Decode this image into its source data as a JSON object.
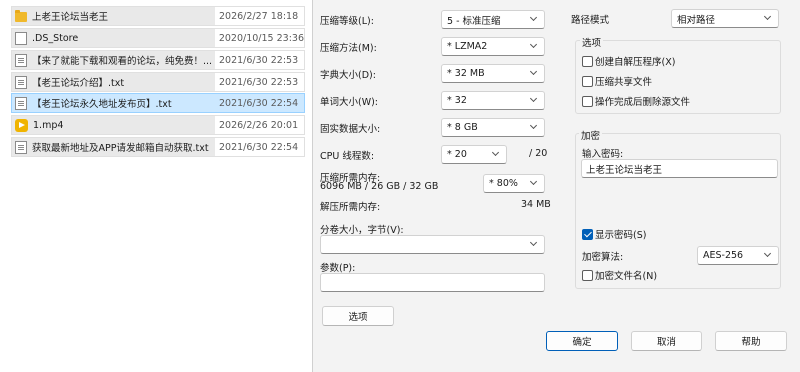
{
  "files": [
    {
      "name": "上老王论坛当老王",
      "date": "2026/2/27 18:18",
      "icon": "folder-icon",
      "selected": false
    },
    {
      "name": ".DS_Store",
      "date": "2020/10/15 23:36",
      "icon": "file-icon",
      "selected": false
    },
    {
      "name": "【来了就能下载和观看的论坛，纯免费！...",
      "date": "2021/6/30 22:53",
      "icon": "text-file-icon",
      "selected": false
    },
    {
      "name": "【老王论坛介绍】.txt",
      "date": "2021/6/30 22:53",
      "icon": "text-file-icon",
      "selected": false
    },
    {
      "name": "【老王论坛永久地址发布页】.txt",
      "date": "2021/6/30 22:54",
      "icon": "text-file-icon",
      "selected": true
    },
    {
      "name": "1.mp4",
      "date": "2026/2/26 20:01",
      "icon": "media-file-icon",
      "selected": false
    },
    {
      "name": "获取最新地址及APP请发邮箱自动获取.txt",
      "date": "2021/6/30 22:54",
      "icon": "text-file-icon",
      "selected": false
    }
  ],
  "dialog": {
    "compression_level_label": "压缩等级(L):",
    "compression_level_value": "5 - 标准压缩",
    "method_label": "压缩方法(M):",
    "method_value": "* LZMA2",
    "dict_label": "字典大小(D):",
    "dict_value": "* 32 MB",
    "word_label": "单词大小(W):",
    "word_value": "* 32",
    "solid_label": "固实数据大小:",
    "solid_value": "* 8 GB",
    "threads_label": "CPU 线程数:",
    "threads_value": "* 20",
    "threads_total": "/ 20",
    "mem_label": "压缩所需内存:",
    "mem_detail": "6096 MB / 26 GB / 32 GB",
    "mem_value": "* 80%",
    "decomp_label": "解压所需内存:",
    "decomp_value": "34 MB",
    "split_label": "分卷大小，字节(V):",
    "split_value": "",
    "params_label": "参数(P):",
    "params_value": "",
    "options_button": "选项",
    "path_mode_label": "路径模式",
    "path_mode_value": "相对路径",
    "options_group_title": "选项",
    "opt_sfx": "创建自解压程序(X)",
    "opt_shared": "压缩共享文件",
    "opt_delete": "操作完成后删除源文件",
    "encryption_group_title": "加密",
    "password_label": "输入密码:",
    "password_value": "上老王论坛当老王",
    "show_password": "显示密码(S)",
    "enc_method_label": "加密算法:",
    "enc_method_value": "AES-256",
    "encrypt_names": "加密文件名(N)",
    "ok_button": "确定",
    "cancel_button": "取消",
    "help_button": "帮助",
    "accent_color": "#005fb8"
  }
}
